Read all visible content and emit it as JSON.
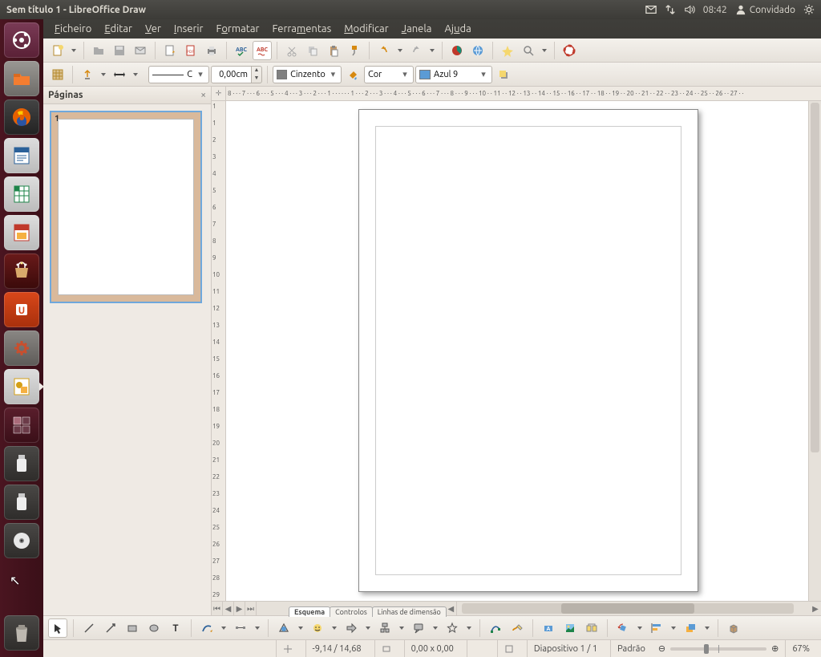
{
  "window": {
    "title": "Sem título 1 - LibreOffice Draw"
  },
  "panel": {
    "time": "08:42",
    "user": "Convidado"
  },
  "menu": {
    "ficheiro": "Ficheiro",
    "editar": "Editar",
    "ver": "Ver",
    "inserir": "Inserir",
    "formatar": "Formatar",
    "ferramentas": "Ferramentas",
    "modificar": "Modificar",
    "janela": "Janela",
    "ajuda": "Ajuda"
  },
  "pages_panel": {
    "title": "Páginas",
    "page1_num": "1",
    "close": "×"
  },
  "line_toolbar": {
    "line_style_display": "C",
    "line_width": "0,00cm",
    "line_color_label": "Cinzento",
    "fill_mode": "Cor",
    "fill_color_label": "Azul 9",
    "line_color_hex": "#808080",
    "fill_color_hex": "#5b9bd5"
  },
  "ruler_h": "8 · · · 7 · · · 6 · · · 5 · · · 4 · · · 3 · · · 2 · · · 1 · · · · · · 1 · · · 2 · · · 3 · · · 4 · · · 5 · · · 6 · · · 7 · · · 8 · · · 9 · · · 10 · · 11 · · 12 · · 13 · · 14 · · 15 · · 16 · · 17 · · 18 · · 19 · · 20 · · 21 · · 22 · · 23 · · 24 · · 25 · · 26 · · 27 · ·",
  "ruler_v": [
    "1",
    "1",
    "2",
    "3",
    "4",
    "5",
    "6",
    "7",
    "8",
    "9",
    "10",
    "11",
    "12",
    "13",
    "14",
    "15",
    "16",
    "17",
    "18",
    "19",
    "20",
    "21",
    "22",
    "23",
    "24",
    "25",
    "26",
    "27",
    "28",
    "29"
  ],
  "tabs": {
    "esquema": "Esquema",
    "controlos": "Controlos",
    "linhas": "Linhas de dimensão"
  },
  "status": {
    "pos": "-9,14 / 14,68",
    "size": "0,00 x 0,00",
    "slide": "Diapositivo 1 / 1",
    "style": "Padrão",
    "zoom": "67%",
    "minus": "⊖",
    "plus": "⊕"
  }
}
